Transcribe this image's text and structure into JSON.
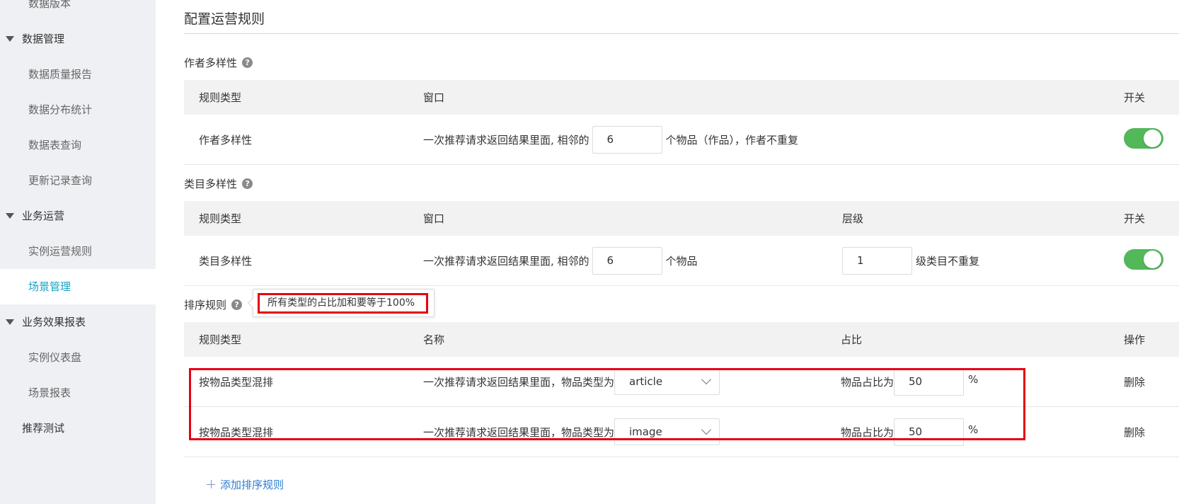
{
  "colors": {
    "sidebar_bg": "#eef0f3",
    "active": "#12a4c6",
    "toggle_on": "#52b85a",
    "link": "#2e7bcf",
    "highlight": "#e50012",
    "table_header_bg": "#f2f2f2"
  },
  "icons": {
    "group_caret": "caret-down-icon",
    "help": "question-circle-icon",
    "select_chevron": "chevron-down-icon",
    "add": "plus-icon"
  },
  "sidebar": {
    "items": [
      {
        "label": "数据版本"
      },
      {
        "label": "数据管理",
        "icon": "caret-down-icon"
      },
      {
        "label": "数据质量报告"
      },
      {
        "label": "数据分布统计"
      },
      {
        "label": "数据表查询"
      },
      {
        "label": "更新记录查询"
      },
      {
        "label": "业务运营",
        "icon": "caret-down-icon"
      },
      {
        "label": "实例运营规则"
      },
      {
        "label": "场景管理",
        "active": true
      },
      {
        "label": "业务效果报表",
        "icon": "caret-down-icon"
      },
      {
        "label": "实例仪表盘"
      },
      {
        "label": "场景报表"
      },
      {
        "label": "推荐测试"
      }
    ]
  },
  "page": {
    "title": "配置运营规则"
  },
  "author_diversity": {
    "section_label": "作者多样性",
    "columns": {
      "rule_type": "规则类型",
      "window": "窗口",
      "switch": "开关"
    },
    "row": {
      "rule_type": "作者多样性",
      "text_before": "一次推荐请求返回结果里面, 相邻的",
      "window_value": "6",
      "text_after": "个物品（作品），作者不重复",
      "switch_on": true
    }
  },
  "category_diversity": {
    "section_label": "类目多样性",
    "columns": {
      "rule_type": "规则类型",
      "window": "窗口",
      "level": "层级",
      "switch": "开关"
    },
    "row": {
      "rule_type": "类目多样性",
      "text_before": "一次推荐请求返回结果里面, 相邻的",
      "window_value": "6",
      "text_after": "个物品",
      "level_value": "1",
      "level_suffix": "级类目不重复",
      "switch_on": true
    }
  },
  "ranking_rules": {
    "section_label": "排序规则",
    "tooltip": "所有类型的占比加和要等于100%",
    "columns": {
      "rule_type": "规则类型",
      "name": "名称",
      "ratio": "占比",
      "action": "操作"
    },
    "rows": [
      {
        "rule_type": "按物品类型混排",
        "name_prefix": "一次推荐请求返回结果里面，物品类型为",
        "item_type": "article",
        "ratio_prefix": "物品占比为",
        "ratio_value": "50",
        "ratio_unit": "%",
        "action": "删除"
      },
      {
        "rule_type": "按物品类型混排",
        "name_prefix": "一次推荐请求返回结果里面，物品类型为",
        "item_type": "image",
        "ratio_prefix": "物品占比为",
        "ratio_value": "50",
        "ratio_unit": "%",
        "action": "删除"
      }
    ],
    "add_label": "添加排序规则"
  }
}
